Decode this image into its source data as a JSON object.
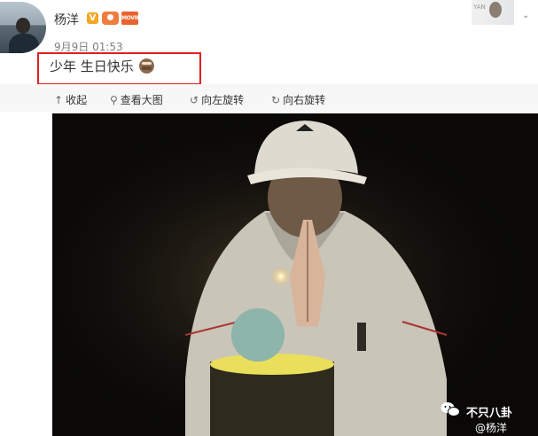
{
  "post": {
    "username": "杨洋",
    "timestamp": "9月9日 01:53",
    "text": "少年 生日快乐",
    "verified_badge": "V",
    "movie_badge": "MOVIE",
    "corner_watermark": "YAN"
  },
  "toolbar": {
    "collapse": "收起",
    "view_large": "查看大图",
    "rotate_left": "向左旋转",
    "rotate_right": "向右旋转"
  },
  "image": {
    "watermark_account": "不只八卦",
    "weibo_credit": "@杨洋"
  },
  "colors": {
    "highlight": "#e02020",
    "verified": "#f5a623",
    "photo_bg": "#0a0908"
  },
  "icons": [
    "avatar",
    "verified-badge-icon",
    "fan-badge-icon",
    "movie-badge-icon",
    "cake-emoji-icon",
    "collapse-arrow-icon",
    "magnifier-icon",
    "rotate-left-icon",
    "rotate-right-icon",
    "wechat-icon"
  ]
}
